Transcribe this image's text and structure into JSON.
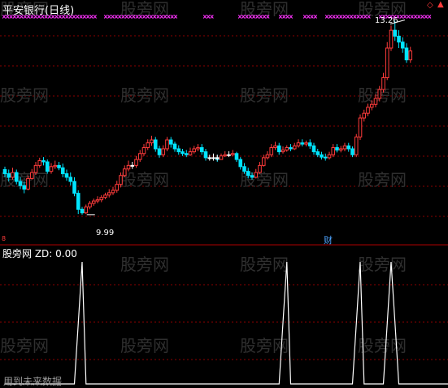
{
  "chart_title": "平安银行(日线)",
  "indicator_title": "股旁网 ZD: 0.00",
  "footer_text": "用到未来数据",
  "finance_marker": "财",
  "price_low_label": "9.99",
  "price_high_label": "13.26",
  "side_marker": "8",
  "diamond_icon": "◇",
  "up_icon": "▲",
  "watermark_text": "股旁网",
  "colors": {
    "up": "#ff3b3b",
    "down": "#00e5ff",
    "doji": "#ffffff",
    "grid": "#8b0000",
    "cross_marker": "#ff33ff",
    "indicator_line": "#ffffff",
    "finance_marker": "#4da3ff"
  },
  "chart_data": [
    {
      "type": "candlestick",
      "title": "平安银行(日线)",
      "annotations": [
        {
          "x": 21,
          "label": "9.99"
        },
        {
          "x": 104,
          "label": "13.26"
        }
      ],
      "x": [
        0,
        1,
        2,
        3,
        4,
        5,
        6,
        7,
        8,
        9,
        10,
        11,
        12,
        13,
        14,
        15,
        16,
        17,
        18,
        19,
        20,
        21,
        22,
        23,
        24,
        25,
        26,
        27,
        28,
        29,
        30,
        31,
        32,
        33,
        34,
        35,
        36,
        37,
        38,
        39,
        40,
        41,
        42,
        43,
        44,
        45,
        46,
        47,
        48,
        49,
        50,
        51,
        52,
        53,
        54,
        55,
        55,
        56,
        57,
        58,
        59,
        60,
        61,
        62,
        63,
        64,
        65,
        66,
        67,
        68,
        69,
        70,
        71,
        72,
        73,
        74,
        75,
        76,
        77,
        78,
        79,
        80,
        81,
        82,
        83,
        84,
        85,
        86,
        87,
        88,
        89,
        90,
        91,
        92,
        93,
        94,
        95,
        96,
        97,
        98,
        99,
        100,
        101,
        102,
        103,
        104,
        105,
        106
      ],
      "open": [
        10.75,
        10.68,
        10.62,
        10.7,
        10.55,
        10.48,
        10.42,
        10.6,
        10.7,
        10.82,
        10.9,
        10.88,
        10.72,
        10.8,
        10.82,
        10.78,
        10.68,
        10.62,
        10.55,
        10.35,
        10.08,
        10.02,
        10.12,
        10.18,
        10.22,
        10.24,
        10.28,
        10.32,
        10.36,
        10.4,
        10.5,
        10.65,
        10.76,
        10.82,
        10.82,
        10.92,
        11.02,
        11.12,
        11.2,
        11.25,
        11.1,
        11.0,
        11.1,
        11.25,
        11.18,
        11.1,
        11.05,
        11.02,
        11.0,
        11.05,
        11.1,
        11.12,
        11.05,
        10.95,
        10.95,
        10.95,
        10.95,
        10.92,
        10.98,
        11.0,
        11.0,
        11.02,
        10.92,
        10.8,
        10.72,
        10.65,
        10.62,
        10.7,
        10.82,
        10.95,
        11.0,
        11.12,
        11.15,
        11.05,
        11.08,
        11.12,
        11.1,
        11.15,
        11.2,
        11.18,
        11.2,
        11.15,
        11.05,
        11.0,
        10.96,
        10.95,
        11.0,
        11.12,
        11.08,
        11.1,
        11.15,
        11.1,
        11.0,
        11.3,
        11.62,
        11.7,
        11.8,
        11.85,
        11.95,
        12.1,
        12.3,
        12.8,
        13.1,
        13.0,
        12.9,
        12.8,
        12.6
      ],
      "close": [
        10.68,
        10.62,
        10.7,
        10.55,
        10.48,
        10.42,
        10.6,
        10.7,
        10.82,
        10.9,
        10.88,
        10.72,
        10.8,
        10.82,
        10.78,
        10.68,
        10.62,
        10.55,
        10.35,
        10.08,
        10.02,
        10.12,
        10.18,
        10.22,
        10.24,
        10.28,
        10.32,
        10.36,
        10.4,
        10.5,
        10.65,
        10.76,
        10.82,
        10.82,
        10.92,
        11.02,
        11.12,
        11.2,
        11.25,
        11.1,
        11.0,
        11.1,
        11.25,
        11.18,
        11.1,
        11.05,
        11.02,
        11.0,
        11.05,
        11.1,
        11.12,
        11.05,
        10.95,
        10.95,
        10.95,
        10.92,
        10.95,
        10.98,
        11.0,
        11.0,
        11.02,
        10.92,
        10.8,
        10.72,
        10.65,
        10.62,
        10.7,
        10.82,
        10.95,
        11.0,
        11.12,
        11.15,
        11.05,
        11.08,
        11.12,
        11.1,
        11.15,
        11.2,
        11.18,
        11.2,
        11.15,
        11.05,
        11.0,
        10.96,
        10.95,
        11.0,
        11.12,
        11.08,
        11.1,
        11.15,
        11.1,
        11.0,
        11.3,
        11.62,
        11.7,
        11.8,
        11.85,
        11.95,
        12.1,
        12.3,
        12.8,
        13.1,
        13.0,
        12.9,
        12.8,
        12.6,
        12.75
      ],
      "high": [
        10.8,
        10.75,
        10.78,
        10.75,
        10.62,
        10.55,
        10.65,
        10.76,
        10.88,
        10.95,
        10.96,
        10.92,
        10.86,
        10.9,
        10.88,
        10.85,
        10.75,
        10.7,
        10.62,
        10.4,
        10.12,
        10.16,
        10.22,
        10.26,
        10.3,
        10.32,
        10.36,
        10.42,
        10.46,
        10.56,
        10.7,
        10.82,
        10.9,
        10.88,
        10.98,
        11.08,
        11.18,
        11.26,
        11.32,
        11.3,
        11.15,
        11.16,
        11.3,
        11.3,
        11.22,
        11.16,
        11.1,
        11.08,
        11.12,
        11.15,
        11.18,
        11.18,
        11.1,
        11.0,
        11.02,
        11.0,
        11.0,
        11.02,
        11.06,
        11.06,
        11.08,
        11.05,
        10.96,
        10.86,
        10.78,
        10.7,
        10.76,
        10.88,
        11.0,
        11.06,
        11.18,
        11.22,
        11.2,
        11.14,
        11.16,
        11.18,
        11.2,
        11.26,
        11.26,
        11.24,
        11.26,
        11.2,
        11.1,
        11.05,
        11.02,
        11.05,
        11.18,
        11.18,
        11.15,
        11.2,
        11.2,
        11.14,
        11.35,
        11.68,
        11.76,
        11.86,
        11.92,
        12.02,
        12.16,
        12.38,
        12.9,
        13.18,
        13.26,
        13.1,
        12.98,
        12.88,
        12.82
      ],
      "low": [
        10.62,
        10.55,
        10.58,
        10.5,
        10.42,
        10.35,
        10.4,
        10.58,
        10.66,
        10.78,
        10.82,
        10.68,
        10.68,
        10.76,
        10.74,
        10.62,
        10.56,
        10.48,
        10.3,
        10.0,
        9.99,
        10.0,
        10.08,
        10.14,
        10.18,
        10.2,
        10.25,
        10.28,
        10.32,
        10.36,
        10.45,
        10.62,
        10.72,
        10.76,
        10.78,
        10.88,
        10.98,
        11.08,
        11.15,
        11.05,
        10.95,
        10.96,
        11.06,
        11.12,
        11.05,
        11.0,
        10.98,
        10.96,
        10.98,
        11.02,
        11.06,
        11.0,
        10.9,
        10.9,
        10.9,
        10.88,
        10.9,
        10.92,
        10.96,
        10.96,
        10.98,
        10.88,
        10.75,
        10.68,
        10.6,
        10.58,
        10.6,
        10.68,
        10.8,
        10.92,
        10.96,
        11.08,
        11.0,
        11.02,
        11.05,
        11.06,
        11.08,
        11.12,
        11.14,
        11.14,
        11.1,
        11.0,
        10.96,
        10.92,
        10.9,
        10.92,
        10.96,
        11.04,
        11.04,
        11.06,
        11.05,
        10.96,
        10.96,
        11.25,
        11.56,
        11.65,
        11.75,
        11.8,
        11.9,
        12.05,
        12.26,
        12.75,
        12.92,
        12.8,
        12.72,
        12.55,
        12.55
      ]
    },
    {
      "type": "line",
      "title": "股旁网 ZD: 0.00",
      "series": [
        {
          "name": "ZD",
          "x": [
            0,
            17,
            18,
            19,
            20,
            21,
            70,
            71,
            72,
            73,
            74,
            89,
            90,
            91,
            92,
            93,
            98,
            99,
            100,
            101,
            102,
            115
          ],
          "values": [
            0,
            0,
            0,
            0.5,
            1,
            0,
            0,
            0,
            0.5,
            1,
            0,
            0,
            0,
            0.5,
            1,
            0,
            0,
            0.5,
            1,
            0.5,
            0,
            0
          ]
        }
      ],
      "ylim": [
        0,
        1
      ]
    }
  ]
}
